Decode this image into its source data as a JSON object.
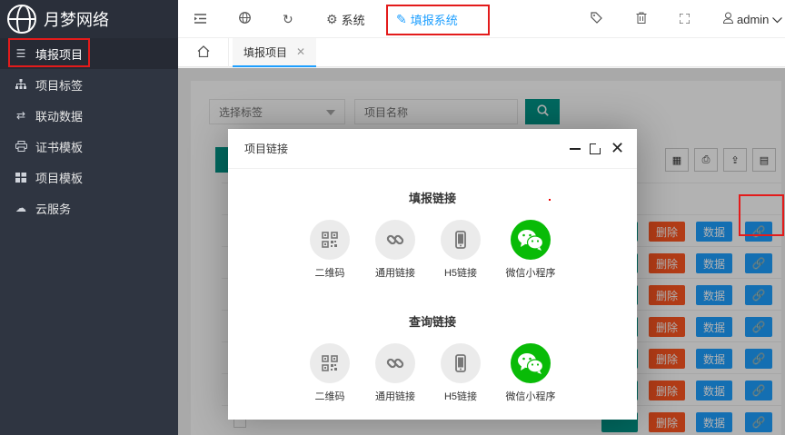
{
  "app": {
    "name": "月梦网络"
  },
  "sidebar": {
    "items": [
      {
        "label": "填报项目",
        "icon": "list-icon",
        "active": true
      },
      {
        "label": "项目标签",
        "icon": "sitemap-icon",
        "active": false
      },
      {
        "label": "联动数据",
        "icon": "exchange-icon",
        "active": false
      },
      {
        "label": "证书模板",
        "icon": "print-icon",
        "active": false
      },
      {
        "label": "项目模板",
        "icon": "grid-icon",
        "active": false
      },
      {
        "label": "云服务",
        "icon": "cloud-icon",
        "active": false
      }
    ]
  },
  "topbar": {
    "system_label": "系统",
    "fill_system_label": "填报系统",
    "user": "admin"
  },
  "tabs": {
    "current": "填报项目"
  },
  "filter": {
    "select_placeholder": "选择标签",
    "name_placeholder": "项目名称"
  },
  "table": {
    "buttons": {
      "delete": "删除",
      "data": "数据"
    },
    "rows": 7
  },
  "modal": {
    "title": "项目链接",
    "sections": [
      {
        "title": "填报链接",
        "items": [
          {
            "label": "二维码",
            "icon": "qrcode-icon"
          },
          {
            "label": "通用链接",
            "icon": "link-icon"
          },
          {
            "label": "H5链接",
            "icon": "mobile-icon"
          },
          {
            "label": "微信小程序",
            "icon": "wechat-icon"
          }
        ]
      },
      {
        "title": "查询链接",
        "items": [
          {
            "label": "二维码",
            "icon": "qrcode-icon"
          },
          {
            "label": "通用链接",
            "icon": "link-icon"
          },
          {
            "label": "H5链接",
            "icon": "mobile-icon"
          },
          {
            "label": "微信小程序",
            "icon": "wechat-icon"
          }
        ]
      }
    ]
  },
  "colors": {
    "sidebar": "#2f3541",
    "accent": "#1e9fff",
    "teal": "#009688",
    "danger": "#ff5722",
    "wechat": "#09bb07",
    "highlight": "#e31b1b"
  }
}
